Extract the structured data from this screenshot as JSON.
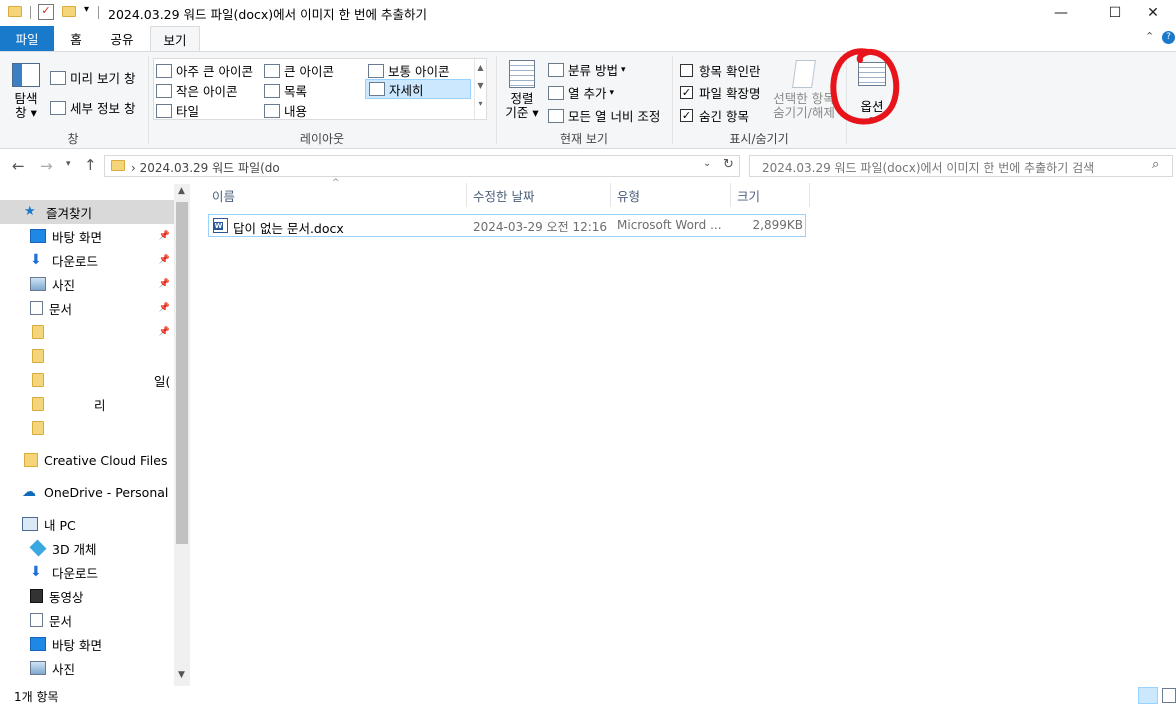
{
  "window": {
    "title": "2024.03.29 워드 파일(docx)에서 이미지 한 번에 추출하기",
    "minimize": "—",
    "maximize": "☐",
    "close": "✕"
  },
  "tabs": [
    {
      "label": "파일"
    },
    {
      "label": "홈"
    },
    {
      "label": "공유"
    },
    {
      "label": "보기"
    }
  ],
  "ribbon": {
    "pane_group": {
      "nav_pane": "탐색\n창",
      "nav_pane_line1": "탐색",
      "nav_pane_line2": "창",
      "preview_pane": "미리 보기 창",
      "details_pane": "세부 정보 창",
      "label": "창"
    },
    "layout_group": {
      "items": [
        "아주 큰 아이콘",
        "큰 아이콘",
        "보통 아이콘",
        "작은 아이콘",
        "목록",
        "자세히",
        "타일",
        "내용"
      ],
      "selected": "자세히",
      "label": "레이아웃"
    },
    "current_view_group": {
      "sort_line1": "정렬",
      "sort_line2": "기준",
      "group_by": "분류 방법",
      "add_columns": "열 추가",
      "fit_columns": "모든 열 너비 조정",
      "label": "현재 보기"
    },
    "show_hide_group": {
      "item_checkboxes": "항목 확인란",
      "item_checkboxes_checked": false,
      "file_extensions": "파일 확장명",
      "file_extensions_checked": true,
      "hidden_items": "숨긴 항목",
      "hidden_items_checked": true,
      "hide_selected_line1": "선택한 항목",
      "hide_selected_line2": "숨기기/해제",
      "label": "표시/숨기기"
    },
    "options": {
      "label": "옵션"
    }
  },
  "address": {
    "path_partial": "› 2024.03.29 워드 파일(do",
    "search_placeholder": "2024.03.29 워드 파일(docx)에서 이미지 한 번에 추출하기 검색"
  },
  "nav": {
    "quick_access": "즐겨찾기",
    "pinned": [
      "바탕 화면",
      "다운로드",
      "사진",
      "문서"
    ],
    "folders_blurred": [
      "일(",
      "리"
    ],
    "creative_cloud": "Creative Cloud Files",
    "onedrive": "OneDrive - Personal",
    "this_pc": "내 PC",
    "pc_items": [
      "3D 개체",
      "다운로드",
      "동영상",
      "문서",
      "바탕 화면",
      "사진"
    ]
  },
  "columns": [
    "이름",
    "수정한 날짜",
    "유형",
    "크기"
  ],
  "files": [
    {
      "name": "답이 없는 문서.docx",
      "modified": "2024-03-29 오전 12:16",
      "type": "Microsoft Word ...",
      "size": "2,899KB"
    }
  ],
  "status": {
    "count": "1개 항목"
  },
  "colors": {
    "file_tab": "#1979ca",
    "ribbon_bg": "#f5f6f7",
    "selection": "#cce8ff",
    "highlight_circle": "#e8141b"
  }
}
